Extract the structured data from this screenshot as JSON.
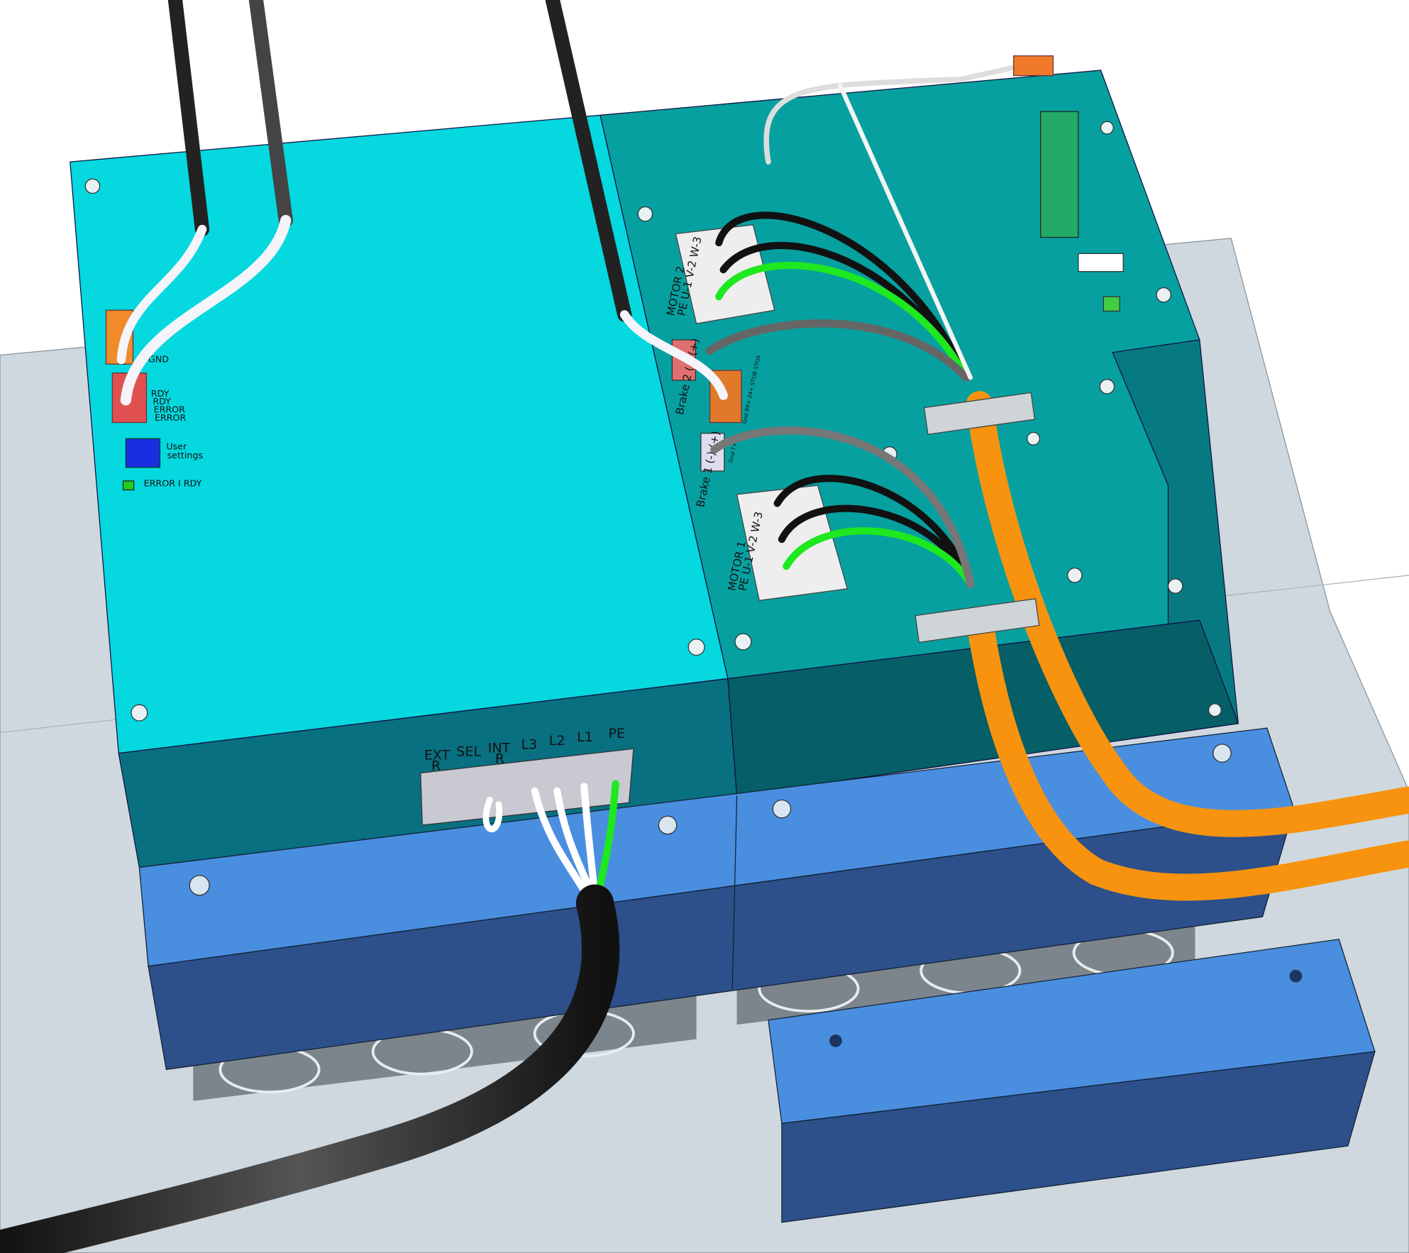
{
  "scene": {
    "title": "Drive controller enclosure assembly",
    "colors": {
      "housing_top_left": "#05d8df",
      "housing_top_right": "#07a0a0",
      "housing_front": "#087080",
      "bracket_top": "#4a8ee0",
      "bracket_front": "#2d4f8a",
      "plate": "#cfd8de",
      "motor_cable": "#f7930e",
      "pe_wire": "#1ee81e"
    }
  },
  "left_panel": {
    "io_top_label": "GND",
    "relay_labels": [
      "RDY",
      "RDY",
      "ERROR",
      "ERROR"
    ],
    "dip_label_1": "User",
    "dip_label_2": "settings",
    "led_label": "ERROR I RDY"
  },
  "right_panel": {
    "motor2_title": "MOTOR 2",
    "motor2_pins": "PE  U-1  V-2  W-3",
    "brake2_label": "Brake 2 (-) (+)",
    "safety_pins": "Gnd BR+ 24+ STOB STOA",
    "brake1_label": "Brake 1 (-) (+)",
    "brake1_pins": "Gnd T+",
    "motor1_title": "MOTOR 1",
    "motor1_pins": "PE  U-1  V-2  W-3"
  },
  "mains_terminal": {
    "labels": [
      {
        "top": "EXT",
        "bottom": "R"
      },
      {
        "top": "SEL",
        "bottom": ""
      },
      {
        "top": "INT",
        "bottom": "R"
      },
      {
        "top": "L3",
        "bottom": ""
      },
      {
        "top": "L2",
        "bottom": ""
      },
      {
        "top": "L1",
        "bottom": ""
      },
      {
        "top": "PE",
        "bottom": ""
      }
    ]
  }
}
